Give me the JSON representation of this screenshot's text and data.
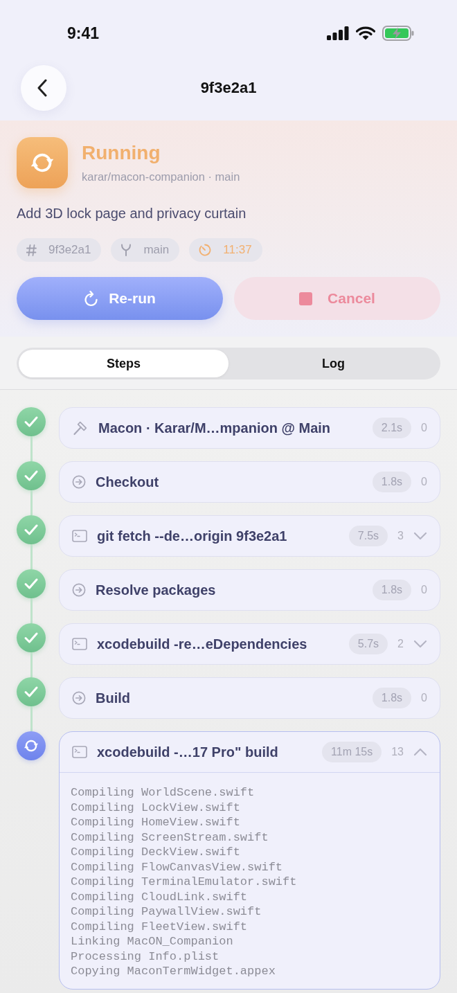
{
  "status_bar": {
    "time": "9:41"
  },
  "nav": {
    "title": "9f3e2a1"
  },
  "run": {
    "kind": "running",
    "status": "Running",
    "repo": "karar/macon-companion · main",
    "message": "Add 3D lock page and privacy curtain",
    "chips": [
      {
        "kind": "commit",
        "label": "9f3e2a1"
      },
      {
        "kind": "branch",
        "label": "main"
      },
      {
        "kind": "timer",
        "label": "11:37"
      }
    ]
  },
  "actions": [
    {
      "kind": "rerun",
      "label": "Re-run"
    },
    {
      "kind": "cancel",
      "label": "Cancel"
    }
  ],
  "tabs": [
    {
      "label": "Steps",
      "selected": true
    },
    {
      "label": "Log",
      "selected": false
    }
  ],
  "steps": [
    {
      "kind": "hammer",
      "running": false,
      "title": "Macon · Karar/M…mpanion @ Main",
      "duration": "2.1s",
      "line_count": "0"
    },
    {
      "kind": "action",
      "running": false,
      "title": "Checkout",
      "duration": "1.8s",
      "line_count": "0"
    },
    {
      "kind": "shell",
      "running": false,
      "title": "git fetch --de…origin 9f3e2a1",
      "duration": "7.5s",
      "line_count": "3",
      "expanded": false
    },
    {
      "kind": "action",
      "running": false,
      "title": "Resolve packages",
      "duration": "1.8s",
      "line_count": "0"
    },
    {
      "kind": "shell",
      "running": false,
      "title": "xcodebuild -re…eDependencies",
      "duration": "5.7s",
      "line_count": "2",
      "expanded": false
    },
    {
      "kind": "action",
      "running": false,
      "title": "Build",
      "duration": "1.8s",
      "line_count": "0"
    },
    {
      "kind": "shell",
      "running": true,
      "title": "xcodebuild -…17 Pro\" build",
      "duration": "11m 15s",
      "line_count": "13",
      "expanded": true,
      "log": [
        "Compiling WorldScene.swift",
        "Compiling LockView.swift",
        "Compiling HomeView.swift",
        "Compiling ScreenStream.swift",
        "Compiling DeckView.swift",
        "Compiling FlowCanvasView.swift",
        "Compiling TerminalEmulator.swift",
        "Compiling CloudLink.swift",
        "Compiling PaywallView.swift",
        "Compiling FleetView.swift",
        "Linking MacON_Companion",
        "Processing Info.plist",
        "Copying MaconTermWidget.appex"
      ]
    }
  ]
}
